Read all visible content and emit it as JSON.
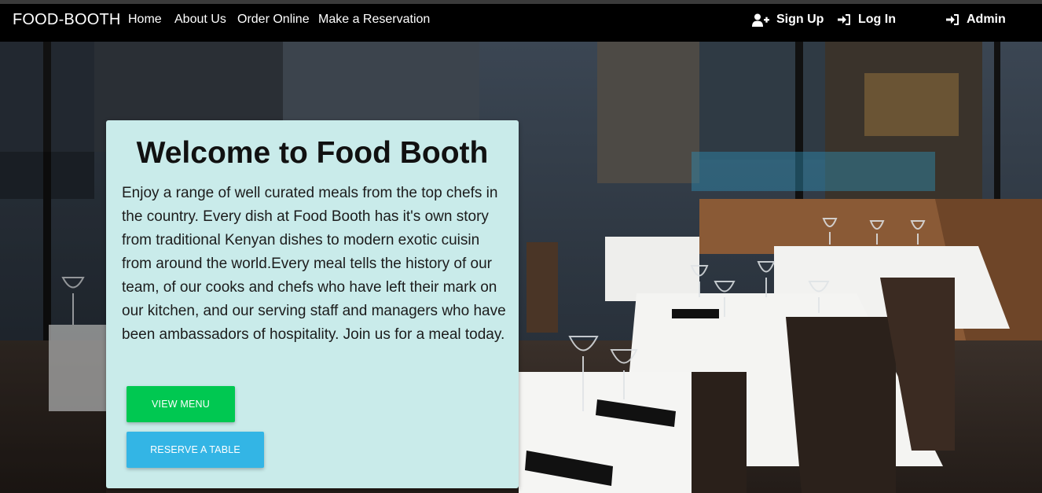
{
  "navbar": {
    "brand": "FOOD-BOOTH",
    "links": [
      "Home",
      "About Us",
      "Order Online",
      "Make a Reservation"
    ],
    "signup_label": "Sign Up",
    "login_label": "Log In",
    "admin_label": "Admin"
  },
  "hero": {
    "title": "Welcome to Food Booth",
    "description": "Enjoy a range of well curated meals from the top chefs in the country. Every dish at Food Booth has it's own story from traditional Kenyan dishes to modern exotic cuisin from around the world.Every meal tells the history of our team, of our cooks and chefs who have left their mark on our kitchen, and our serving staff and managers who have been ambassadors of hospitality. Join us for a meal today.",
    "view_menu_label": "VIEW MENU",
    "reserve_label": "RESERVE A TABLE"
  },
  "colors": {
    "navbar_bg": "#000000",
    "card_bg": "#c9ebea",
    "view_menu_button": "#00c851",
    "reserve_button": "#33b5e5"
  }
}
